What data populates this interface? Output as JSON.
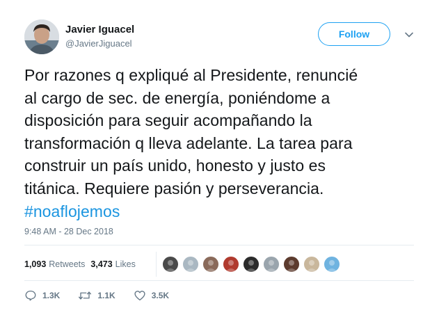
{
  "author": {
    "name": "Javier Iguacel",
    "handle": "@JavierJiguacel"
  },
  "follow_label": "Follow",
  "tweet": {
    "line1": "Por razones q expliqué al Presidente, renuncié",
    "line2": "al cargo de sec. de energía, poniéndome a",
    "line3": "disposición para seguir acompañando la",
    "line4": "transformación q lleva adelante. La tarea para",
    "line5": "construir un país unido, honesto y justo es",
    "line6": "titánica. Requiere pasión y perseverancia.",
    "hashtag": "#noaflojemos"
  },
  "timestamp": "9:48 AM - 28 Dec 2018",
  "stats": {
    "retweets_count": "1,093",
    "retweets_label": "Retweets",
    "likes_count": "3,473",
    "likes_label": "Likes"
  },
  "likers": [
    {
      "icon": "liker-avatar",
      "color": "#4a4a4a"
    },
    {
      "icon": "liker-avatar",
      "color": "#aab8c2"
    },
    {
      "icon": "liker-avatar",
      "color": "#8a6a5a"
    },
    {
      "icon": "liker-avatar",
      "color": "#b03a2e"
    },
    {
      "icon": "liker-avatar",
      "color": "#2b2b2b"
    },
    {
      "icon": "liker-avatar",
      "color": "#9aa5ad"
    },
    {
      "icon": "liker-avatar",
      "color": "#5c3b2e"
    },
    {
      "icon": "liker-avatar",
      "color": "#c9b79c"
    },
    {
      "icon": "liker-avatar",
      "color": "#6fb3e0"
    }
  ],
  "actions": {
    "replies": "1.3K",
    "retweets": "1.1K",
    "likes": "3.5K"
  },
  "colors": {
    "accent": "#1da1f2",
    "hashtag": "#1b95e0",
    "secondary_text": "#657786",
    "divider": "#e6ecf0"
  }
}
